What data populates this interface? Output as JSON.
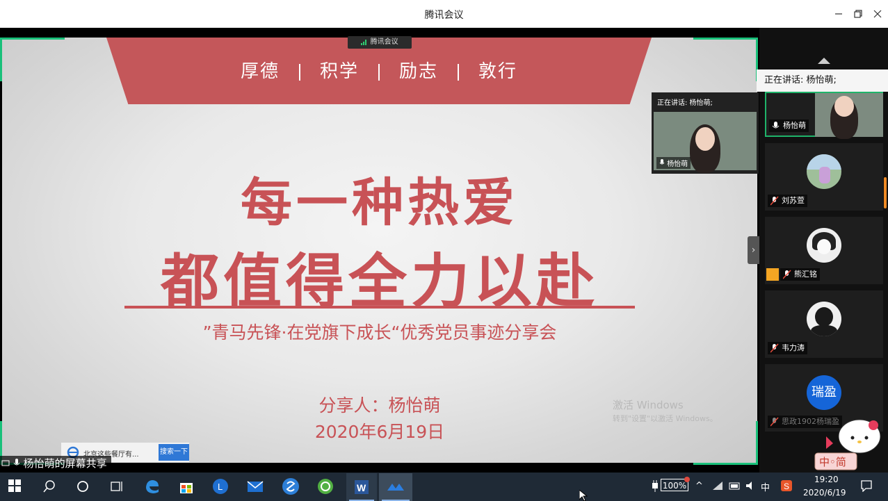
{
  "window": {
    "title": "腾讯会议"
  },
  "share_badge": {
    "label": "腾讯会议"
  },
  "slide": {
    "banner_items": [
      "厚德",
      "积学",
      "励志",
      "敦行"
    ],
    "headline_line1": "每一种热爱",
    "headline_line2": "都值得全力以赴",
    "subtitle": "”青马先锋·在党旗下成长“优秀党员事迹分享会",
    "presenter": "分享人：杨怡萌",
    "date": "2020年6月19日",
    "watermark_line1": "激活 Windows",
    "watermark_line2": "转到\"设置\"以激活 Windows。"
  },
  "floating_video": {
    "speaking_label": "正在讲话: 杨怡萌;",
    "name": "杨怡萌"
  },
  "screen_share_label": "杨怡萌的屏幕共享",
  "browser_popup": {
    "text": "北京这些餐厅有...",
    "button": "搜索一下"
  },
  "sidebar": {
    "speaking_label": "正在讲话: 杨怡萌;",
    "participants": [
      {
        "name": "杨怡萌",
        "active": true,
        "muted": false
      },
      {
        "name": "刘苏萱",
        "active": false,
        "muted": true
      },
      {
        "name": "熊汇铭",
        "active": false,
        "muted": true
      },
      {
        "name": "韦力涛",
        "active": false,
        "muted": true
      },
      {
        "name": "思政1902杨瑞盈",
        "active": false,
        "muted": true,
        "avatar_text": "瑞盈"
      }
    ]
  },
  "ime_sticker_text": "中◦简",
  "taskbar": {
    "battery": "100%",
    "ime": "中",
    "time": "19:20",
    "date": "2020/6/19"
  },
  "colors": {
    "accent_red": "#c85256",
    "green_frame": "#19c07a",
    "taskbar": "#1f2a36"
  }
}
